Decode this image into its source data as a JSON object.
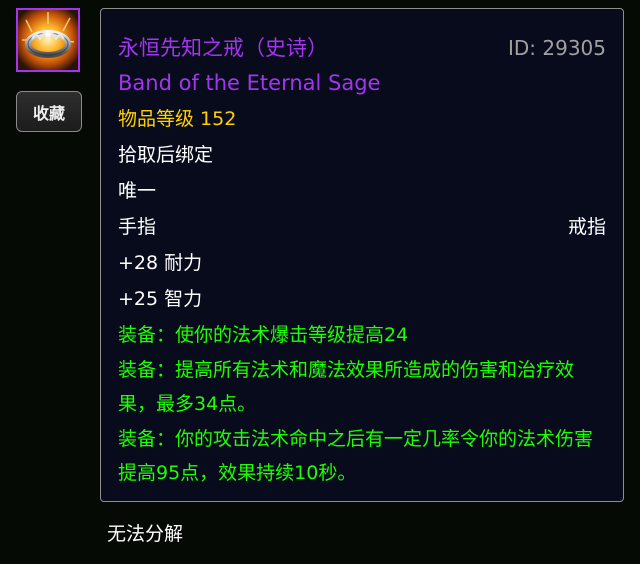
{
  "icon": {
    "name": "ring-icon"
  },
  "sidebar": {
    "favorite_label": "收藏"
  },
  "tooltip": {
    "name_cn": "永恒先知之戒（史诗）",
    "id_label": "ID: 29305",
    "name_en": "Band of the Eternal Sage",
    "item_level": "物品等级 152",
    "bind": "拾取后绑定",
    "unique": "唯一",
    "slot": "手指",
    "type": "戒指",
    "stats": [
      "+28 耐力",
      "+25 智力"
    ],
    "equip_effects": [
      "装备：使你的法术爆击等级提高24",
      "装备：提高所有法术和魔法效果所造成的伤害和治疗效果，最多34点。",
      "装备：你的攻击法术命中之后有一定几率令你的法术伤害提高95点，效果持续10秒。"
    ]
  },
  "footer": {
    "disenchant": "无法分解"
  },
  "colors": {
    "epic": "#a335ee",
    "item_level": "#ffd100",
    "equip": "#1eff00",
    "id": "#a0a0a0",
    "tooltip_bg": "#070b1c",
    "page_bg": "#060a05"
  }
}
